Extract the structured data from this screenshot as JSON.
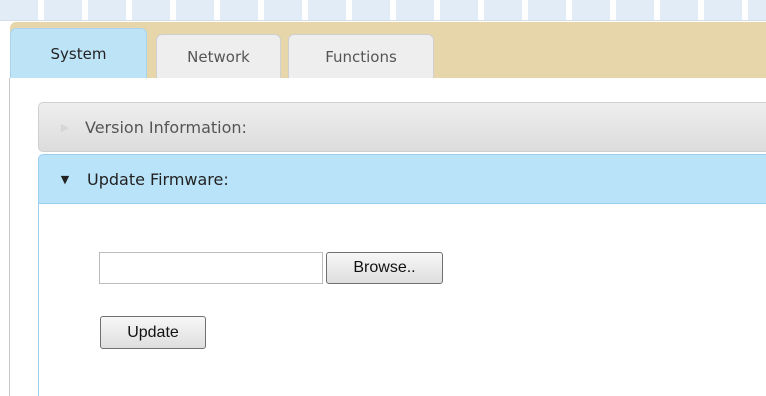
{
  "tabs": [
    {
      "label": "System",
      "active": true
    },
    {
      "label": "Network",
      "active": false
    },
    {
      "label": "Functions",
      "active": false
    }
  ],
  "sections": {
    "version": {
      "label": "Version Information:",
      "expanded": false
    },
    "firmware": {
      "label": "Update Firmware:",
      "expanded": true
    }
  },
  "firmware_form": {
    "file_value": "",
    "browse_label": "Browse..",
    "update_label": "Update"
  },
  "colors": {
    "tabbar_bg": "#e6d6a9",
    "active_tab": "#bde3f7",
    "expanded_header": "#b9e3f8"
  },
  "icons": {
    "collapsed": "triangle-right-icon",
    "expanded": "triangle-down-icon"
  }
}
